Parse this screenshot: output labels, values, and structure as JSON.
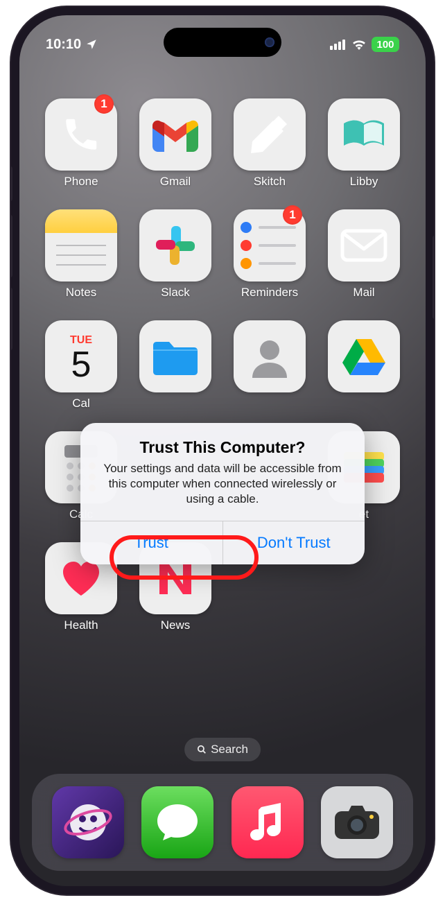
{
  "status": {
    "time": "10:10",
    "battery": "100"
  },
  "apps": {
    "row1": [
      {
        "name": "Phone",
        "badge": "1"
      },
      {
        "name": "Gmail"
      },
      {
        "name": "Skitch"
      },
      {
        "name": "Libby"
      }
    ],
    "row2": [
      {
        "name": "Notes"
      },
      {
        "name": "Slack"
      },
      {
        "name": "Reminders",
        "badge": "1"
      },
      {
        "name": "Mail"
      }
    ],
    "row3": [
      {
        "name": "Calendar",
        "dow": "TUE",
        "day": "5",
        "lbl": "Cal"
      },
      {
        "name": "Files",
        "lbl": ""
      },
      {
        "name": "Contacts",
        "lbl": ""
      },
      {
        "name": "Drive",
        "lbl": ""
      }
    ],
    "row4": [
      {
        "name": "Calculator",
        "lbl": "Calc"
      },
      {
        "name": "Wallet",
        "lbl": "et"
      }
    ],
    "row5": [
      {
        "name": "Health"
      },
      {
        "name": "News"
      }
    ]
  },
  "search": {
    "label": "Search"
  },
  "alert": {
    "title": "Trust This Computer?",
    "message": "Your settings and data will be accessible from this computer when connected wirelessly or using a cable.",
    "trust": "Trust",
    "dont_trust": "Don't Trust"
  }
}
